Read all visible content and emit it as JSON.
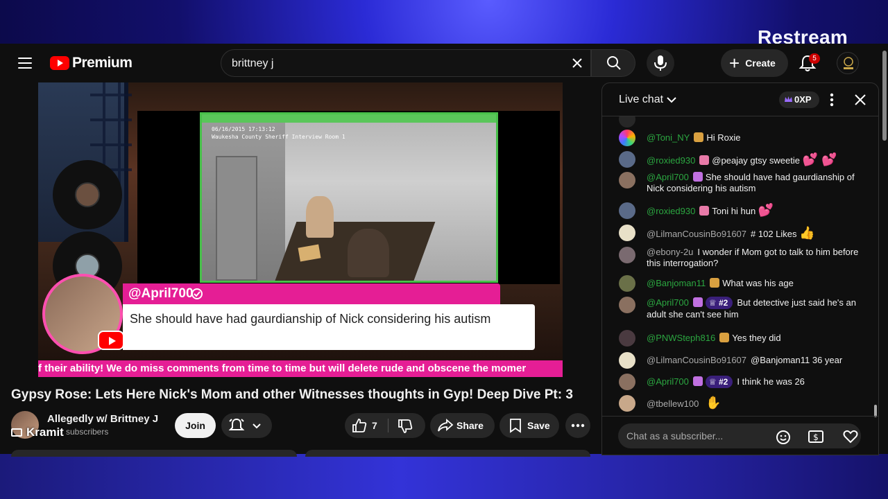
{
  "overlay": {
    "brand": "Restream"
  },
  "header": {
    "logo_text": "Premium",
    "search_value": "brittney j",
    "create_label": "Create",
    "notifications_count": "5"
  },
  "video": {
    "interview_caption_line1": "06/16/2015 17:13:12",
    "interview_caption_line2": "Waukesha County Sheriff Interview Room 1",
    "comment_author": "@April700",
    "comment_text": "She should have had gaurdianship of Nick considering his autism",
    "ticker_text": "f their ability! We do miss comments from time to time but will delete rude and obscene the momer"
  },
  "meta": {
    "title": "Gypsy Rose: Lets Here Nick's Mom and other Witnesses thoughts in Gyp! Deep Dive Pt: 3",
    "channel_name": "Allegedly w/ Brittney J",
    "channel_subs": "subscribers",
    "kramit_label": "Kramit",
    "join_label": "Join",
    "like_count": "7",
    "share_label": "Share",
    "save_label": "Save"
  },
  "chat": {
    "title": "Live chat",
    "xp": "0XP",
    "input_placeholder": "Chat as a subscriber...",
    "messages": [
      {
        "author": "@Toni_NY",
        "text": "Hi Roxie"
      },
      {
        "author": "@roxied930",
        "text": "@peajay gtsy sweetie"
      },
      {
        "author": "@April700",
        "text": "She should have had gaurdianship of Nick considering his autism"
      },
      {
        "author": "@roxied930",
        "text": "Toni hi hun"
      },
      {
        "author": "@LilmanCousinBo91607",
        "text": "# 102 Likes"
      },
      {
        "author": "@ebony-2u",
        "text": "I wonder if Mom got to talk to him before this interrogation?"
      },
      {
        "author": "@Banjoman11",
        "text": "What was his age"
      },
      {
        "author": "@April700",
        "rank": "#2",
        "text": "But detective just said he's an adult she can't see him"
      },
      {
        "author": "@PNWSteph816",
        "text": "Yes they did"
      },
      {
        "author": "@LilmanCousinBo91607",
        "text": "@Banjoman11 36 year"
      },
      {
        "author": "@April700",
        "rank": "#2",
        "text": "I think he was 26"
      },
      {
        "author": "@tbellew100",
        "text": ""
      }
    ]
  },
  "colors": {
    "accent_pink": "#e51e95",
    "youtube_red": "#ff0000",
    "member_green": "#2ba640"
  }
}
